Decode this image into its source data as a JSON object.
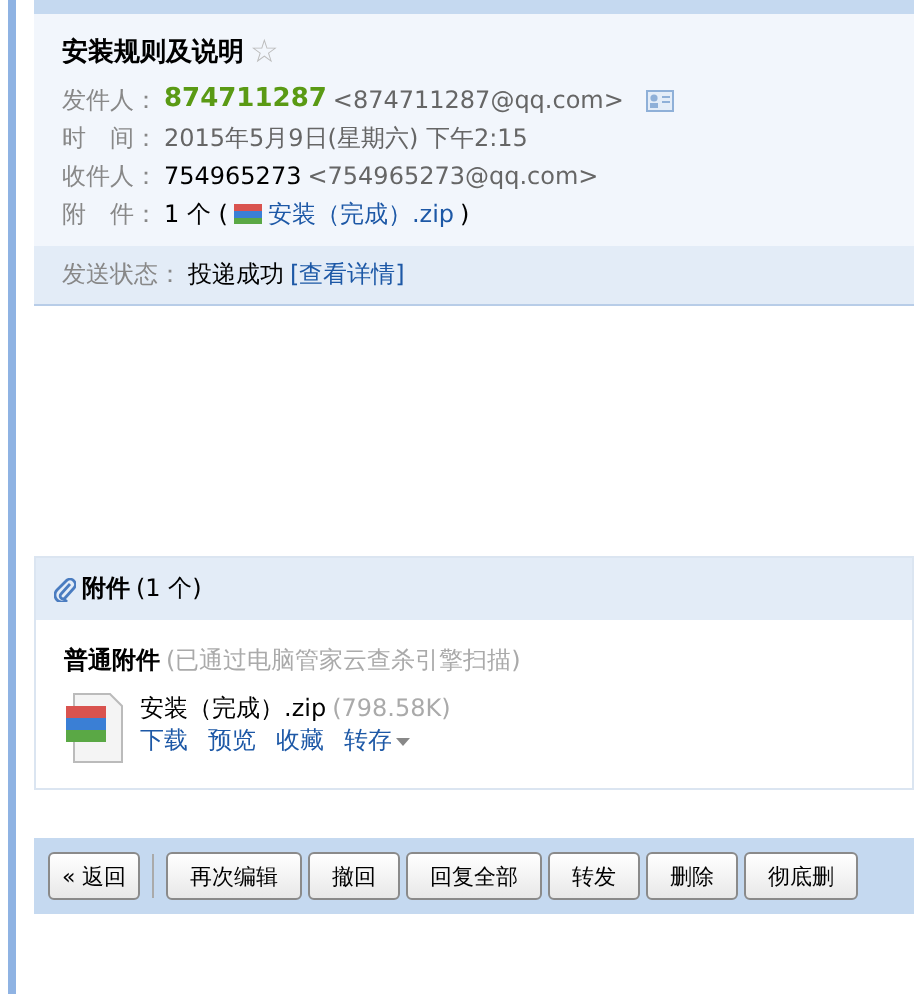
{
  "mail": {
    "subject": "安装规则及说明",
    "starred": false,
    "star": "☆",
    "fields": [
      {
        "kind": "sender",
        "label": "发件人：",
        "name": "874711287",
        "address": "<874711287@qq.com>"
      },
      {
        "kind": "plain",
        "label": "时　间：",
        "value": "2015年5月9日(星期六) 下午2:15"
      },
      {
        "kind": "recipient",
        "label": "收件人：",
        "name": "754965273",
        "address": "<754965273@qq.com>"
      },
      {
        "kind": "attachment",
        "label": "附　件：",
        "count": "1 个 (",
        "file": "安装（完成）.zip",
        "close": ")"
      }
    ],
    "status": {
      "label": "发送状态：",
      "value": "投递成功",
      "link": "[查看详情]"
    }
  },
  "attachments": {
    "title": "附件",
    "count": "(1 个)",
    "section": "普通附件",
    "scan": "(已通过电脑管家云查杀引擎扫描)",
    "files": [
      {
        "name": "安装（完成）.zip",
        "size": "(798.58K)",
        "actions": [
          "下载",
          "预览",
          "收藏",
          "转存"
        ]
      }
    ]
  },
  "toolbar": [
    {
      "label": "« 返回",
      "kind": "back"
    },
    {
      "label": "再次编辑"
    },
    {
      "label": "撤回"
    },
    {
      "label": "回复全部"
    },
    {
      "label": "转发"
    },
    {
      "label": "删除"
    },
    {
      "label": "彻底删"
    }
  ]
}
